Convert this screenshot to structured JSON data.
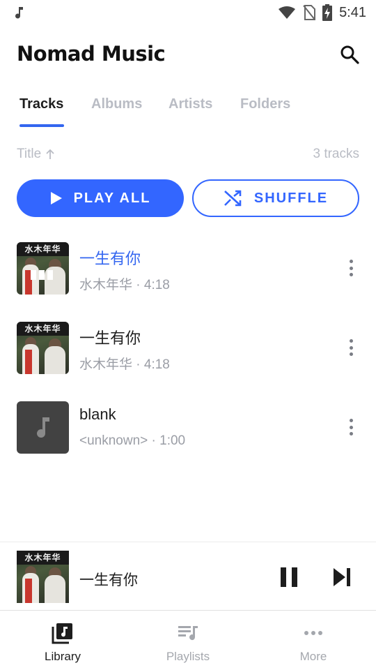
{
  "status_bar": {
    "time": "5:41"
  },
  "header": {
    "title": "Nomad Music"
  },
  "tabs": [
    {
      "label": "Tracks",
      "active": true
    },
    {
      "label": "Albums"
    },
    {
      "label": "Artists"
    },
    {
      "label": "Folders"
    }
  ],
  "sort": {
    "label": "Title",
    "count": "3 tracks"
  },
  "actions": {
    "play_all": "PLAY ALL",
    "shuffle": "SHUFFLE"
  },
  "cover_text": "水木年华",
  "tracks": [
    {
      "title": "一生有你",
      "subtitle": "水木年华 · 4:18",
      "playing": true
    },
    {
      "title": "一生有你",
      "subtitle": "水木年华 · 4:18",
      "playing": false
    },
    {
      "title": "blank",
      "subtitle": "<unknown> · 1:00",
      "playing": false
    }
  ],
  "mini_player": {
    "title": "一生有你"
  },
  "bottom_nav": [
    {
      "label": "Library",
      "active": true
    },
    {
      "label": "Playlists"
    },
    {
      "label": "More"
    }
  ],
  "colors": {
    "accent": "#3366ff",
    "muted": "#b9bcc4"
  }
}
